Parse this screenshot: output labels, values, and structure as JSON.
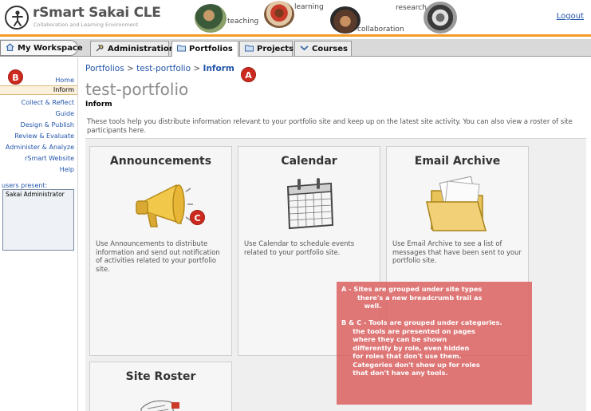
{
  "header": {
    "logo_title": "rSmart Sakai CLE",
    "logo_subtitle": "Collaboration and Learning Environment",
    "hero_words": [
      "teaching",
      "learning",
      "collaboration",
      "research"
    ],
    "logout_label": "Logout"
  },
  "tabs": [
    {
      "label": "My Workspace",
      "icon": "home-icon"
    },
    {
      "label": "Administration",
      "icon": "admin-icon"
    },
    {
      "label": "Portfolios",
      "icon": "folder-icon",
      "active": true
    },
    {
      "label": "Projects",
      "icon": "folder-icon"
    },
    {
      "label": "Courses",
      "icon": "chevron-icon"
    }
  ],
  "sidebar": {
    "items": [
      {
        "label": "Home"
      },
      {
        "label": "Inform",
        "current": true
      },
      {
        "label": "Collect & Reflect"
      },
      {
        "label": "Guide"
      },
      {
        "label": "Design & Publish"
      },
      {
        "label": "Review & Evaluate"
      },
      {
        "label": "Administer & Analyze"
      },
      {
        "label": "rSmart Website"
      },
      {
        "label": "Help"
      }
    ],
    "users_present_label": "users present:",
    "users": [
      "Sakai Administrator"
    ]
  },
  "breadcrumb": {
    "items": [
      "Portfolios",
      "test-portfolio",
      "Inform"
    ],
    "separator": ">"
  },
  "page_title": "test-portfolio",
  "section_title": "Inform",
  "intro": "These tools help you distribute information relevant to your portfolio site and keep up on the latest site activity. You can also view a roster of site participants here.",
  "tools": [
    {
      "title": "Announcements",
      "description": "Use Announcements to distribute information and send out notification of activities related to your portfolio site.",
      "icon": "megaphone-icon"
    },
    {
      "title": "Calendar",
      "description": "Use Calendar to schedule events related to your portfolio site.",
      "icon": "calendar-icon"
    },
    {
      "title": "Email Archive",
      "description": "Use Email Archive to see a list of messages that have been sent to your portfolio site.",
      "icon": "folder-archive-icon"
    },
    {
      "title": "Site Roster",
      "description": "",
      "icon": "roster-icon"
    }
  ],
  "markers": [
    "A",
    "B",
    "C"
  ],
  "annotation": {
    "lines": [
      "A - Sites are grouped under site types",
      "       there's a new breadcrumb trail as",
      "          well.",
      "",
      "B & C - Tools are grouped under categories.",
      "     the tools are presented on pages",
      "     where they can be shown",
      "     differently by role, even hidden",
      "     for roles that don't use them.",
      "     Categories don't show up for roles",
      "     that don't have any tools."
    ]
  },
  "colors": {
    "accent_orange": "#f39b2b",
    "link_blue": "#2255aa",
    "marker_red": "#cc2a1e",
    "note_bg": "#da6060"
  }
}
